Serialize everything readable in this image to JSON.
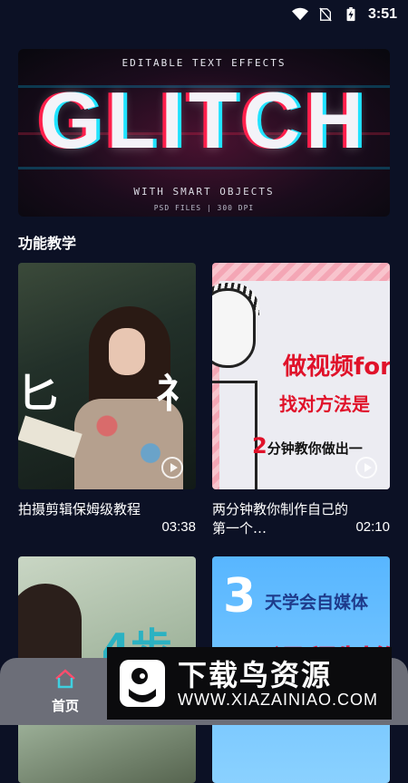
{
  "status_bar": {
    "time": "3:51"
  },
  "banner": {
    "top_text": "EDITABLE TEXT EFFECTS",
    "big_text": "GLITCH",
    "sub_text": "WITH SMART OBJECTS",
    "small_text": "PSD FILES | 300 DPI"
  },
  "section": {
    "title": "功能教学"
  },
  "videos": [
    {
      "title": "拍摄剪辑保姆级教程",
      "duration": "03:38",
      "thumb_left": "匕",
      "thumb_right": "礻"
    },
    {
      "title": "两分钟教你制作自己的第一个…",
      "duration": "02:10",
      "line1": "做视频for",
      "line2": "找对方法是",
      "line3_num": "2",
      "line3": "分钟教你做出一"
    },
    {
      "title": "",
      "duration": "",
      "thumb_text": "4步"
    },
    {
      "title": "",
      "duration": "",
      "num": "3",
      "line1": "天学会自媒体",
      "line2": "一课程制作"
    }
  ],
  "bottom_nav": {
    "home_label": "首页"
  },
  "watermark": {
    "title": "下载鸟资源",
    "url": "WWW.XIAZAINIAO.COM"
  }
}
